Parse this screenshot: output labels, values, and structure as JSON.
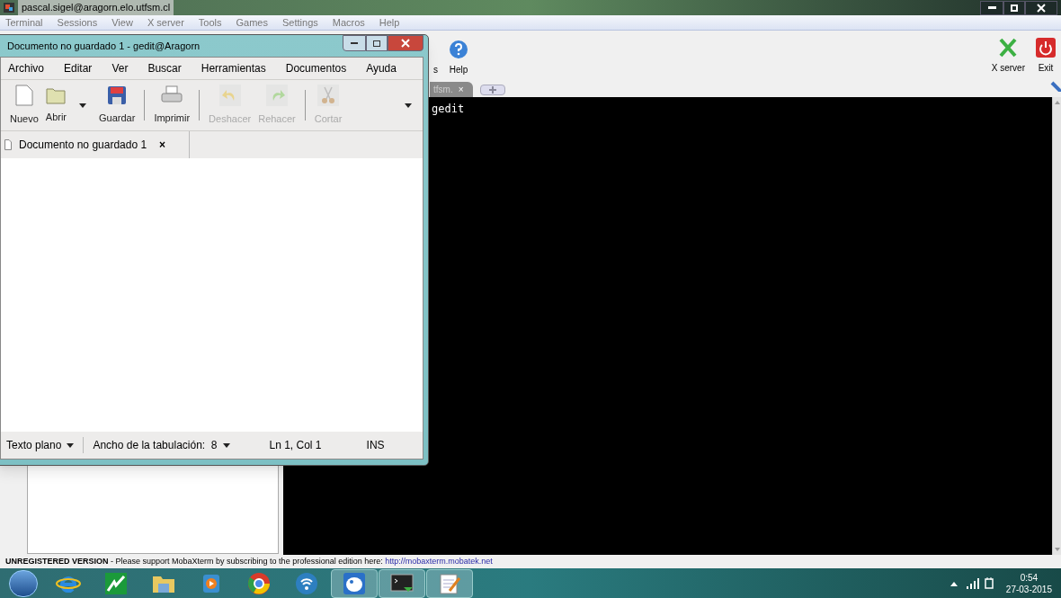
{
  "moba": {
    "title": "pascal.sigel@aragorn.elo.utfsm.cl",
    "menu": [
      "Terminal",
      "Sessions",
      "View",
      "X server",
      "Tools",
      "Games",
      "Settings",
      "Macros",
      "Help"
    ],
    "toolbar_left": [
      {
        "kind": "partial",
        "label": "s"
      },
      {
        "kind": "help",
        "label": "Help"
      }
    ],
    "toolbar_right": [
      {
        "kind": "xserver",
        "label": "X server"
      },
      {
        "kind": "exit",
        "label": "Exit"
      }
    ],
    "tab": {
      "label": "tfsm.",
      "close": "×"
    },
    "terminal_lines": [
      "gedit"
    ],
    "status": {
      "bold": "UNREGISTERED VERSION",
      "text": " - Please support MobaXterm by subscribing to the professional edition here: ",
      "link": "http://mobaxterm.mobatek.net"
    }
  },
  "gedit": {
    "title": "Documento no guardado 1 - gedit@Aragorn",
    "menu": [
      "Archivo",
      "Editar",
      "Ver",
      "Buscar",
      "Herramientas",
      "Documentos",
      "Ayuda"
    ],
    "toolbar": [
      {
        "kind": "new",
        "label": "Nuevo",
        "disabled": false
      },
      {
        "kind": "open",
        "label": "Abrir",
        "disabled": false
      },
      {
        "kind": "save",
        "label": "Guardar",
        "disabled": false
      },
      {
        "kind": "print",
        "label": "Imprimir",
        "disabled": false
      },
      {
        "kind": "undo",
        "label": "Deshacer",
        "disabled": true
      },
      {
        "kind": "redo",
        "label": "Rehacer",
        "disabled": true
      },
      {
        "kind": "cut",
        "label": "Cortar",
        "disabled": true
      }
    ],
    "tab": {
      "label": "Documento no guardado 1",
      "close": "×"
    },
    "status": {
      "language": "Texto plano",
      "tab_width": "Ancho de la tabulación:  8",
      "position": "Ln 1, Col 1",
      "mode": "INS"
    }
  },
  "taskbar": {
    "items": [
      {
        "kind": "ie",
        "active": false
      },
      {
        "kind": "chart",
        "active": false
      },
      {
        "kind": "folder",
        "active": false
      },
      {
        "kind": "media",
        "active": false
      },
      {
        "kind": "browser",
        "active": false
      },
      {
        "kind": "wireless",
        "active": false
      },
      {
        "kind": "paint",
        "active": true
      },
      {
        "kind": "terminal",
        "active": true
      },
      {
        "kind": "notepad",
        "active": true
      }
    ],
    "time": "0:54",
    "date": "27-03-2015"
  }
}
